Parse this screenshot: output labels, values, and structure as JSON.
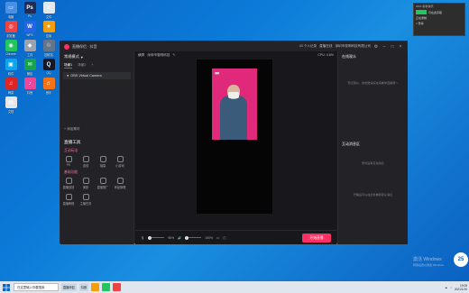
{
  "desktop": {
    "icons": [
      {
        "label": "电脑",
        "color": "#4a90e2",
        "glyph": "▭"
      },
      {
        "label": "Ps",
        "color": "#1f2a55",
        "glyph": "Ps"
      },
      {
        "label": "文件",
        "color": "#e2e8f0",
        "glyph": "≡"
      },
      {
        "label": "浏览器",
        "color": "#ef4444",
        "glyph": "◎"
      },
      {
        "label": "WPS",
        "color": "#2563eb",
        "glyph": "W"
      },
      {
        "label": "应用",
        "color": "#f59e0b",
        "glyph": "★"
      },
      {
        "label": "Chrome",
        "color": "#22c55e",
        "glyph": "◉"
      },
      {
        "label": "工具",
        "color": "#9ca3af",
        "glyph": "◆"
      },
      {
        "label": "回收站",
        "color": "#64748b",
        "glyph": "♲"
      },
      {
        "label": "软件",
        "color": "#0ea5e9",
        "glyph": "▣"
      },
      {
        "label": "微信",
        "color": "#16a34a",
        "glyph": "✉"
      },
      {
        "label": "QQ",
        "color": "#111827",
        "glyph": "Q"
      },
      {
        "label": "网易",
        "color": "#dc2626",
        "glyph": "♫"
      },
      {
        "label": "抖音",
        "color": "#ec4899",
        "glyph": "♪"
      },
      {
        "label": "音乐",
        "color": "#f97316",
        "glyph": "♬"
      },
      {
        "label": "文档",
        "color": "#e5e7eb",
        "glyph": "▤"
      }
    ]
  },
  "app": {
    "title": "直播伴侣 · 抖音",
    "topbar_items": [
      "43 个人记录",
      "直播在线",
      "深圳市惠明科技有限公司"
    ],
    "left": {
      "heading": "常规模式",
      "tabs": [
        "场景1",
        "场景2",
        "+"
      ],
      "source": "OBS Virtual Camera",
      "add_source": "+ 添加素材",
      "section_interact": "互动玩法",
      "tools_title": "直播工具",
      "tools_row1": [
        "PK",
        "连线",
        "福袋",
        "小游戏"
      ],
      "section_assist": "基础功能",
      "tools_row2": [
        "直播回放",
        "美颜",
        "直播推广",
        "商品管理"
      ],
      "tools_row3": [
        "直播教程",
        "主播任务"
      ]
    },
    "center": {
      "preview_title": "横屏",
      "account": "深圳市惠明科技",
      "stats": "CPU: 4.6%",
      "vol_pct": "96%",
      "mic_pct": "100%",
      "go_live": "开始直播"
    },
    "right": {
      "audience_title": "在线观众",
      "audience_text": "暂无观众，快去邀请好友来看你直播吧～",
      "interact_title": "互动消息区",
      "interact_text": "暂时没有互动消息",
      "interact_text2": "开播后可以在此处看到观众消息"
    }
  },
  "taskbar": {
    "search": "在这里输入你要搜索",
    "apps": [
      "直播伴侣",
      "抖音"
    ],
    "time": "19:05",
    "date": "2021/1/10"
  },
  "notification": {
    "header": "2021 新春快乐",
    "line1": "可在此获取",
    "line2": "正在录制",
    "line3": "□ 暂停"
  },
  "watermark": {
    "line1": "激活 Windows",
    "line2": "转到设置以激活 Windows",
    "badge": "25"
  }
}
